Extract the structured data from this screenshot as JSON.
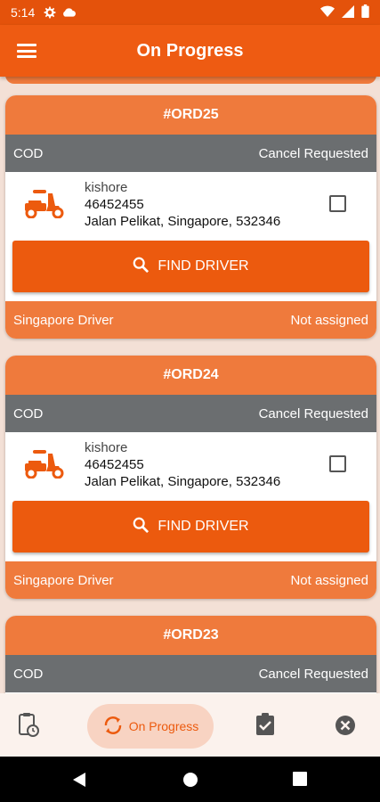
{
  "status_bar": {
    "time": "5:14"
  },
  "app_bar": {
    "title": "On Progress"
  },
  "orders": [
    {
      "id": "#ORD25",
      "payment": "COD",
      "status": "Cancel Requested",
      "customer_name": "kishore",
      "phone": "46452455",
      "address": "Jalan Pelikat, Singapore, 532346",
      "button_label": "FIND DRIVER",
      "driver_type": "Singapore Driver",
      "driver_status": "Not assigned"
    },
    {
      "id": "#ORD24",
      "payment": "COD",
      "status": "Cancel Requested",
      "customer_name": "kishore",
      "phone": "46452455",
      "address": "Jalan Pelikat, Singapore, 532346",
      "button_label": "FIND DRIVER",
      "driver_type": "Singapore Driver",
      "driver_status": "Not assigned"
    },
    {
      "id": "#ORD23",
      "payment": "COD",
      "status": "Cancel Requested"
    }
  ],
  "bottom_nav": {
    "active_label": "On Progress",
    "icons": [
      "pending-clipboard-icon",
      "refresh-icon",
      "assignment-done-icon",
      "cancel-circle-icon"
    ]
  },
  "colors": {
    "primary": "#ee5b12",
    "card_header": "#ef7a3c",
    "pay_row": "#6b6e70",
    "nav_active_bg": "#f8d3c2"
  }
}
